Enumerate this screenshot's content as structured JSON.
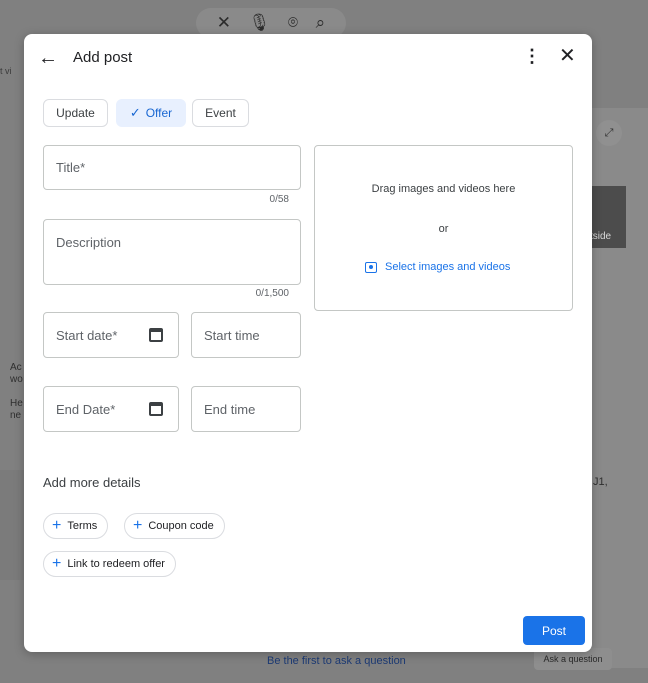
{
  "background": {
    "search_icons": {
      "clear": "✕",
      "mic": "🎙",
      "lens": "⌾",
      "search": "🔍"
    },
    "topleft_text": "t vi",
    "right_text": "tside",
    "left_snippet": [
      "Ac",
      "wo",
      "",
      "He",
      "ne"
    ],
    "right_zip": "J1,",
    "bottom_link": "Be the first to ask a question",
    "ask_button": "Ask a question"
  },
  "dialog": {
    "title": "Add post",
    "back_icon": "back-arrow-icon",
    "more_icon": "more-vert-icon",
    "close_icon": "close-icon",
    "post_types": [
      {
        "label": "Update",
        "selected": false
      },
      {
        "label": "Offer",
        "selected": true
      },
      {
        "label": "Event",
        "selected": false
      }
    ],
    "fields": {
      "title": {
        "label": "Title*",
        "counter": "0/58"
      },
      "description": {
        "label": "Description",
        "counter": "0/1,500"
      },
      "start_date": {
        "label": "Start date*"
      },
      "start_time": {
        "label": "Start time"
      },
      "end_date": {
        "label": "End Date*"
      },
      "end_time": {
        "label": "End time"
      }
    },
    "media": {
      "drag_text": "Drag images and videos here",
      "or_text": "or",
      "select_text": "Select images and videos"
    },
    "more_details": {
      "label": "Add more details",
      "buttons": [
        "Terms",
        "Coupon code",
        "Link to redeem offer"
      ]
    },
    "post_button": "Post",
    "colors": {
      "accent": "#1a73e8",
      "chip_selected_bg": "#e8f0fe"
    }
  }
}
